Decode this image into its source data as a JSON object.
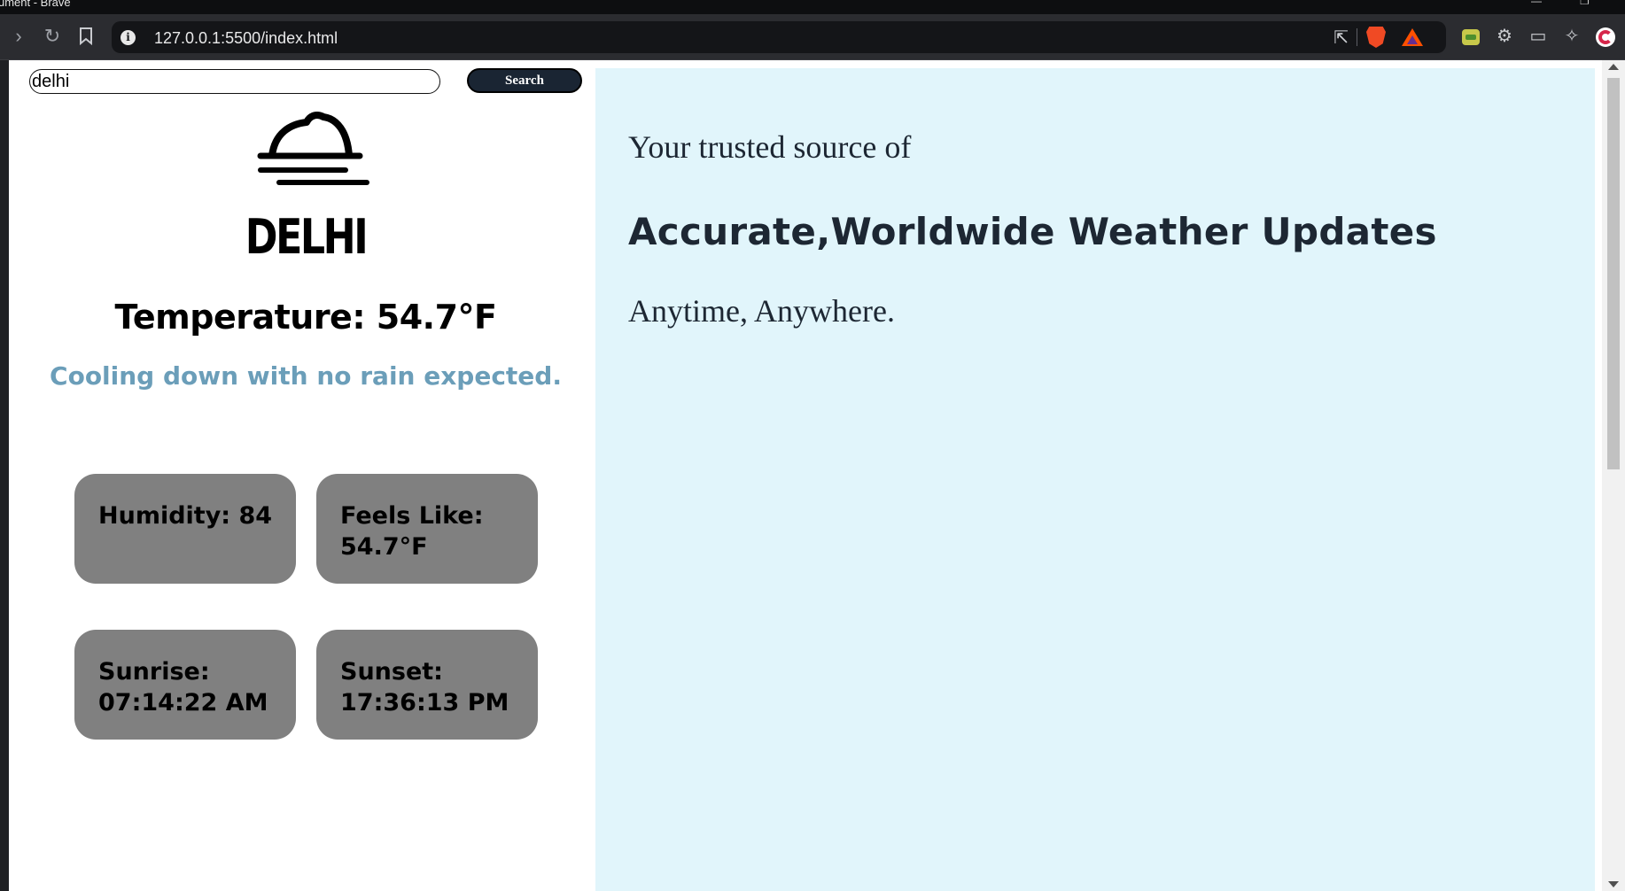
{
  "browser": {
    "window_title": "ument - Brave",
    "url": "127.0.0.1:5500/index.html"
  },
  "search": {
    "value": "delhi",
    "button_label": "Search"
  },
  "weather": {
    "icon": "fog-icon",
    "city": "DELHI",
    "temperature": "Temperature: 54.7°F",
    "description": "Cooling down with no rain expected.",
    "cards": [
      {
        "text": "Humidity: 84"
      },
      {
        "text": "Feels Like: 54.7°F"
      },
      {
        "text": "Sunrise: 07:14:22 AM"
      },
      {
        "text": "Sunset: 17:36:13 PM"
      }
    ]
  },
  "hero": {
    "line1": "Your trusted source of",
    "line2": "Accurate,Worldwide Weather Updates",
    "line3": "Anytime, Anywhere."
  },
  "colors": {
    "panel_right": "#e1f5fb",
    "card": "#808080",
    "description": "#6b9eb9",
    "button": "#1a2533"
  }
}
